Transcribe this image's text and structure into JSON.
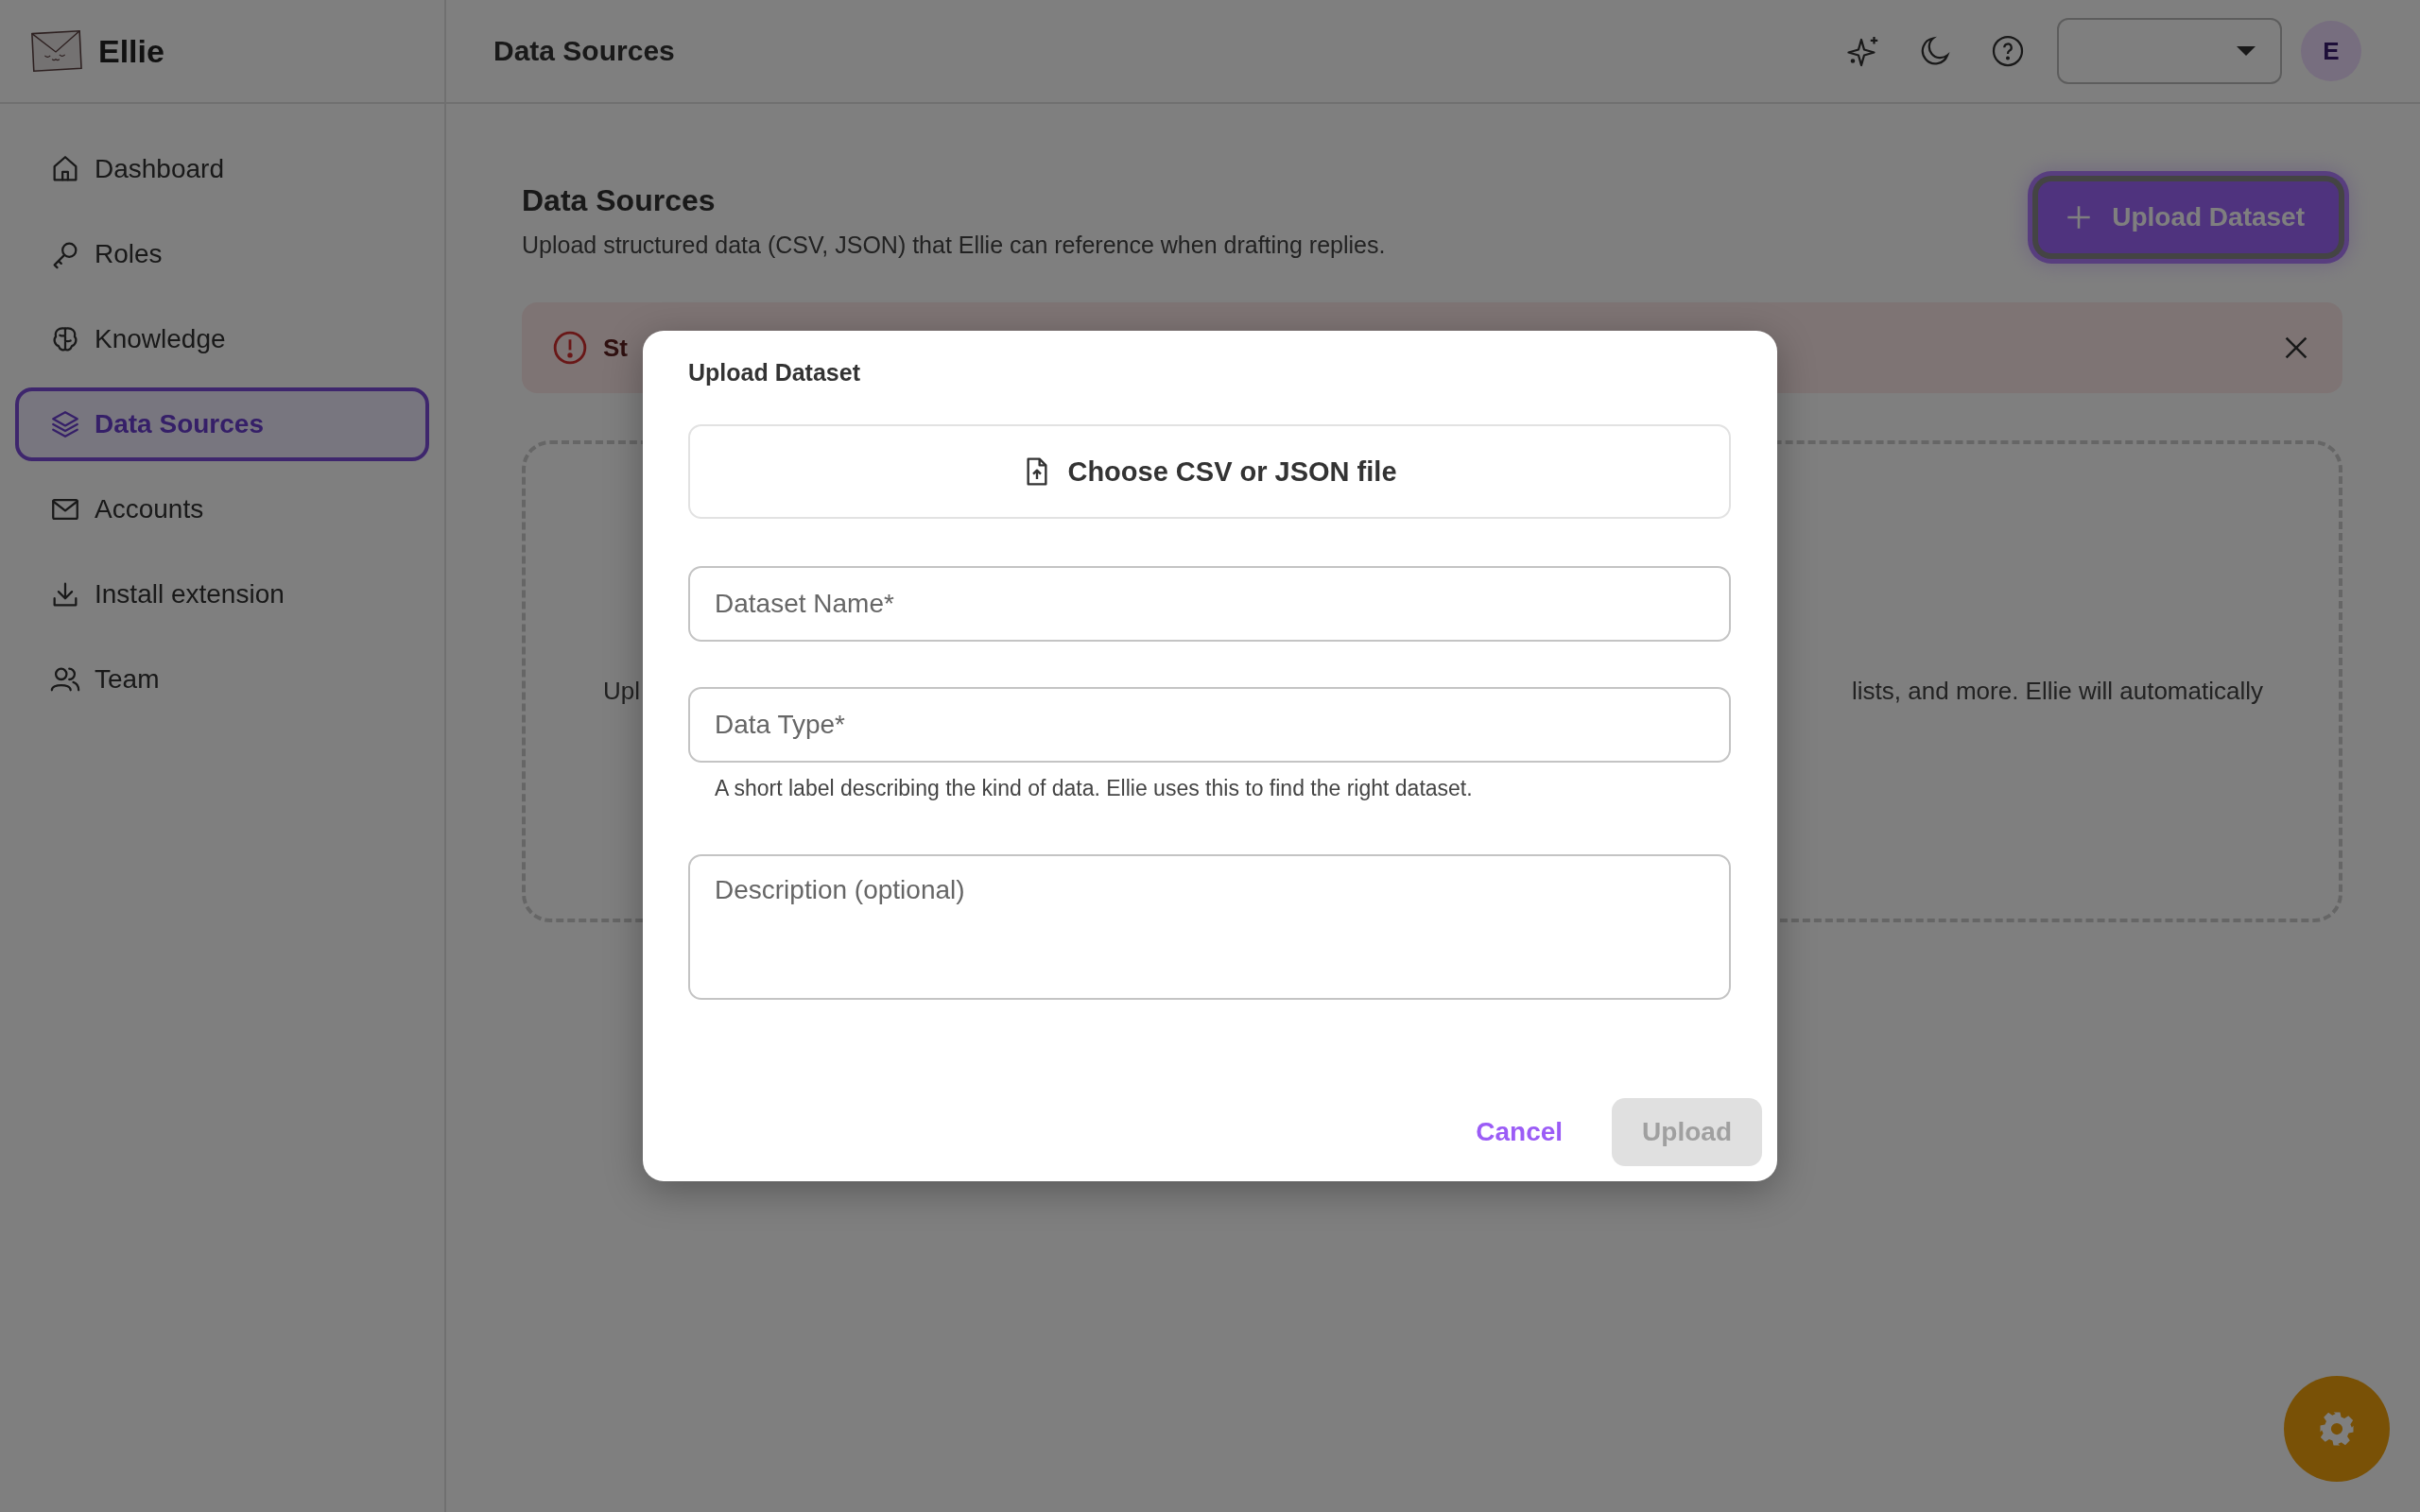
{
  "app": {
    "name": "Ellie"
  },
  "sidebar": {
    "items": [
      {
        "label": "Dashboard",
        "selected": false
      },
      {
        "label": "Roles",
        "selected": false
      },
      {
        "label": "Knowledge",
        "selected": false
      },
      {
        "label": "Data Sources",
        "selected": true
      },
      {
        "label": "Accounts",
        "selected": false
      },
      {
        "label": "Install extension",
        "selected": false
      },
      {
        "label": "Team",
        "selected": false
      }
    ]
  },
  "header": {
    "title": "Data Sources",
    "avatar": "E"
  },
  "page": {
    "title": "Data Sources",
    "subtitle": "Upload structured data (CSV, JSON) that Ellie can reference when drafting replies.",
    "upload_button": "Upload Dataset"
  },
  "alert": {
    "text": "St"
  },
  "empty_state": {
    "text_left": "Upl",
    "text_right": "lists, and more. Ellie will automatically"
  },
  "dialog": {
    "title": "Upload Dataset",
    "file_button": "Choose CSV or JSON file",
    "fields": [
      {
        "kind": "input",
        "placeholder": "Dataset Name*"
      },
      {
        "kind": "input",
        "placeholder": "Data Type*",
        "helper": "A short label describing the kind of data. Ellie uses this to find the right dataset."
      },
      {
        "kind": "textarea",
        "placeholder": "Description (optional)"
      }
    ],
    "cancel": "Cancel",
    "submit": {
      "label": "Upload",
      "disabled": true
    }
  }
}
